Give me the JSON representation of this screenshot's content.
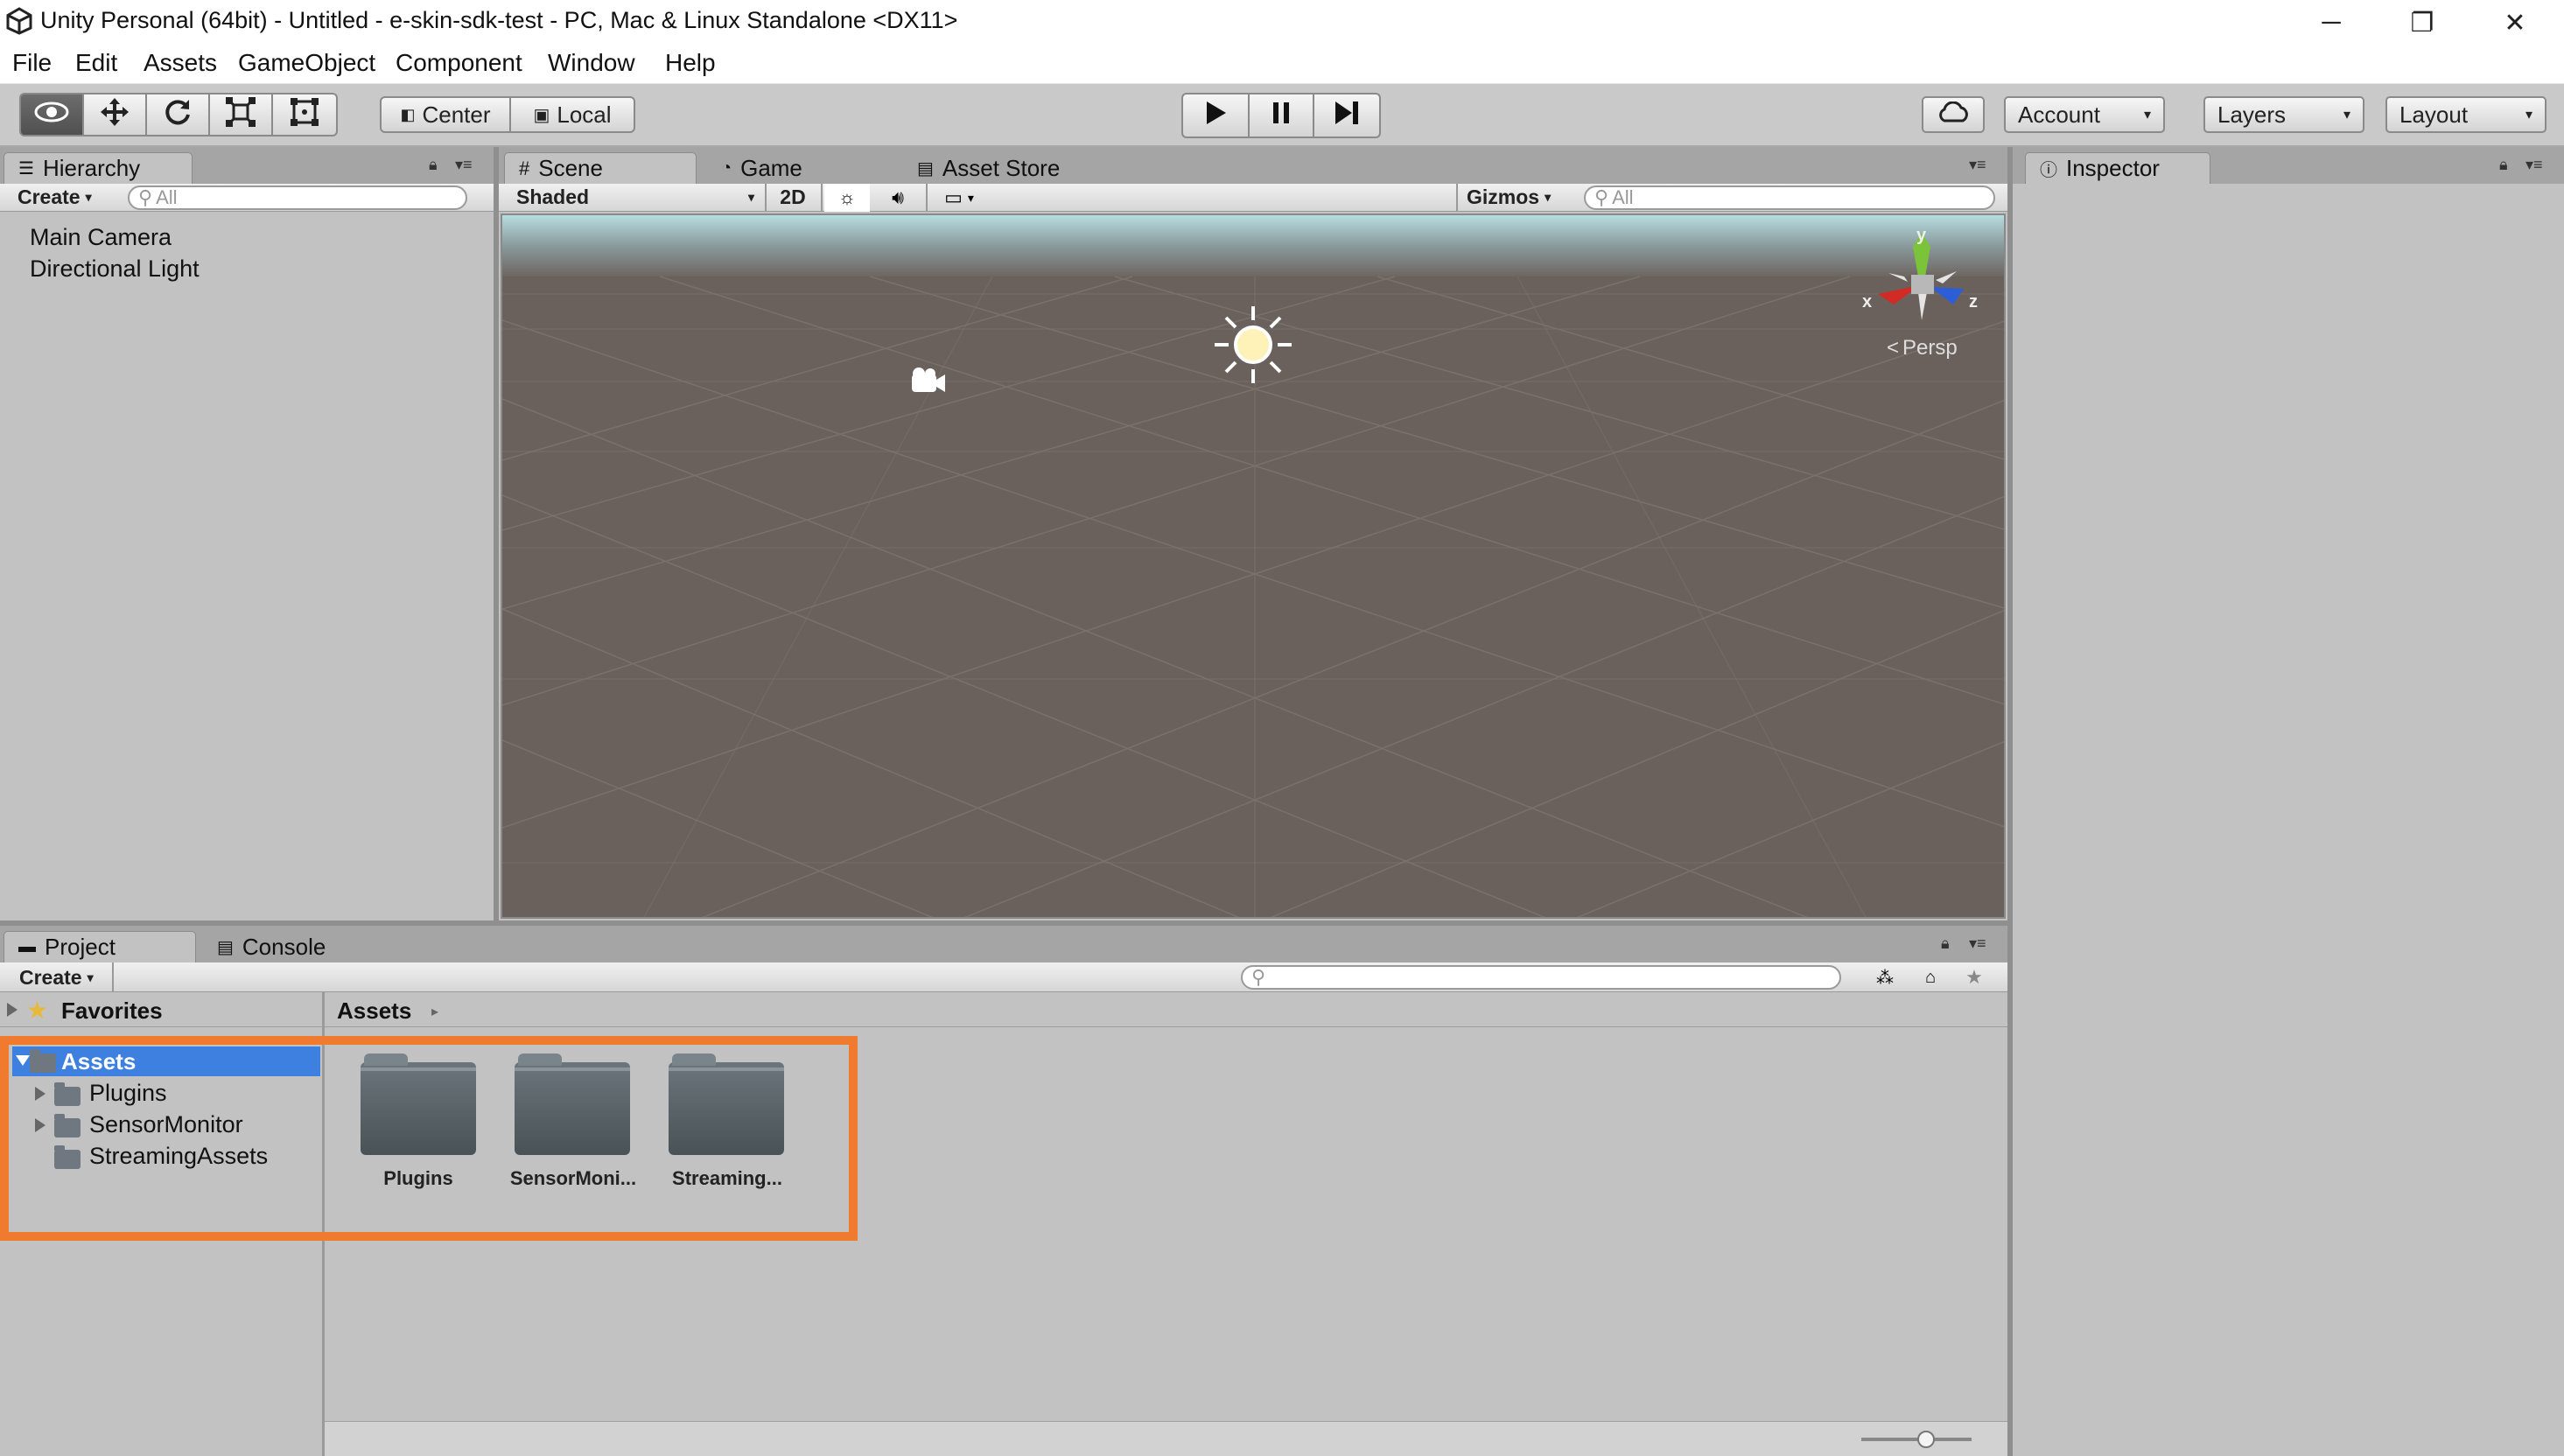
{
  "window": {
    "title": "Unity Personal (64bit) - Untitled - e-skin-sdk-test - PC, Mac & Linux Standalone <DX11>",
    "controls": {
      "minimize": "─",
      "restore": "❐",
      "close": "✕"
    }
  },
  "menu": [
    "File",
    "Edit",
    "Assets",
    "GameObject",
    "Component",
    "Window",
    "Help"
  ],
  "toolbar": {
    "pivot": "Center",
    "space": "Local",
    "account": "Account",
    "layers": "Layers",
    "layout": "Layout",
    "dropdown_arrow": "▾"
  },
  "hierarchy": {
    "tab": "Hierarchy",
    "create": "Create",
    "search_placeholder": "All",
    "items": [
      "Main Camera",
      "Directional Light"
    ]
  },
  "scene": {
    "tabs": [
      "Scene",
      "Game",
      "Asset Store"
    ],
    "draw_mode": "Shaded",
    "mode_2d": "2D",
    "gizmos": "Gizmos",
    "search_placeholder": "All",
    "axis_x": "x",
    "axis_y": "y",
    "axis_z": "z",
    "persp": "Persp"
  },
  "inspector": {
    "tab": "Inspector"
  },
  "project": {
    "tabs": [
      "Project",
      "Console"
    ],
    "create": "Create",
    "favorites": "Favorites",
    "breadcrumb": "Assets",
    "tree": {
      "root": "Assets",
      "children": [
        "Plugins",
        "SensorMonitor",
        "StreamingAssets"
      ]
    },
    "grid": [
      "Plugins",
      "SensorMoni...",
      "Streaming..."
    ]
  },
  "colors": {
    "highlight": "#f07a2e",
    "selection": "#3d80df",
    "scene_ground": "#6a615c",
    "sky": "#a8d4d8"
  }
}
